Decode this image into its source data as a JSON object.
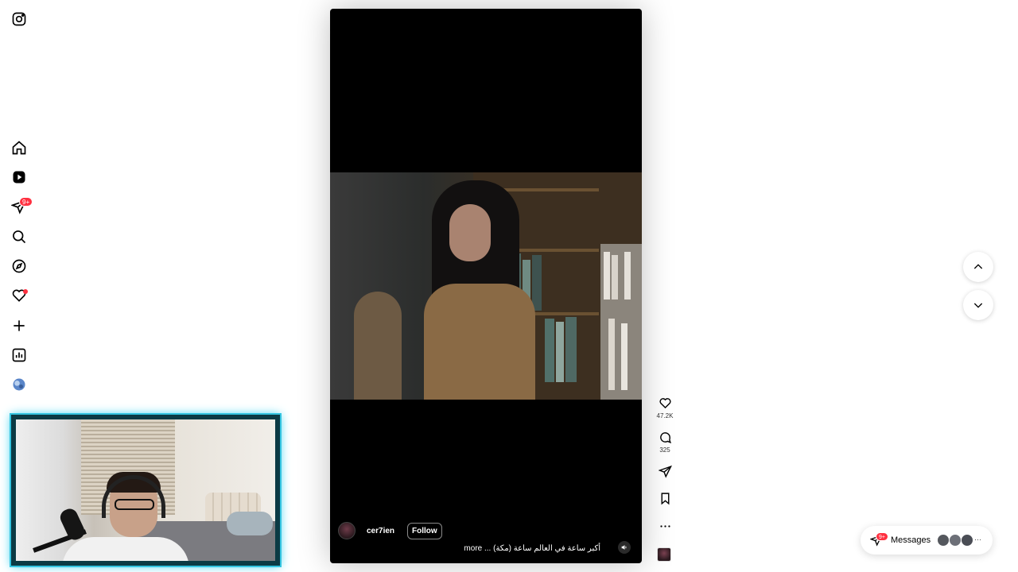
{
  "app": {
    "name": "Instagram Reels"
  },
  "sidebar": {
    "items": [
      {
        "name": "instagram-logo-icon"
      },
      {
        "name": "home-icon"
      },
      {
        "name": "reels-icon"
      },
      {
        "name": "direct-messages-icon",
        "badge": "9+"
      },
      {
        "name": "search-icon"
      },
      {
        "name": "explore-icon"
      },
      {
        "name": "notifications-icon"
      },
      {
        "name": "create-icon"
      },
      {
        "name": "dashboard-icon"
      },
      {
        "name": "profile-avatar-icon"
      }
    ]
  },
  "reel": {
    "author": "cer7ien",
    "follow_label": "Follow",
    "caption": "أكبر ساعة في العالم ساعة (مكة) ... more",
    "actions": {
      "likes": "47.2K",
      "comments": "325"
    }
  },
  "messages": {
    "label": "Messages",
    "badge": "9+",
    "more_glyph": "···"
  },
  "colors": {
    "accent_badge": "#ff3040",
    "webcam_border": "#33c4e0"
  }
}
